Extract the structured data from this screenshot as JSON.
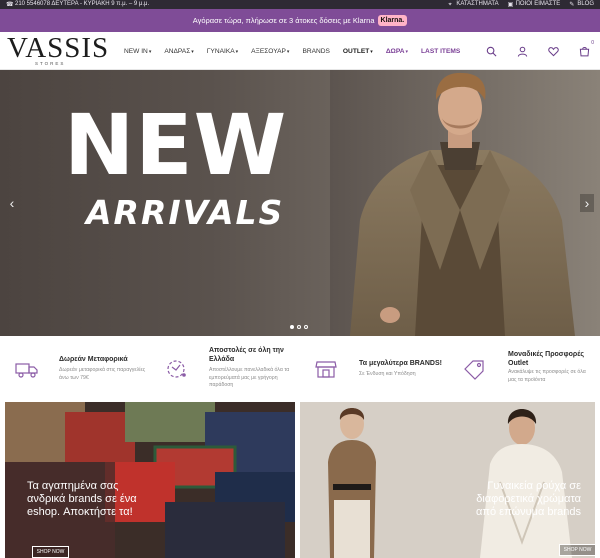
{
  "util_bar": {
    "phone": "210 5546078 ΔΕΥΤΕΡΑ - ΚΥΡΙΑΚΗ 9 π.μ. – 9 μ.μ.",
    "links": [
      "ΚΑΤΑΣΤΗΜΑΤΑ",
      "ΠΟΙΟΙ ΕΙΜΑΣΤΕ",
      "BLOG"
    ]
  },
  "promo": {
    "text": "Αγόρασε τώρα, πλήρωσε σε 3 άτοκες δόσεις με Klarna",
    "badge": "Klarna."
  },
  "header": {
    "logo_main": "VASSIS",
    "logo_sub": "STORES",
    "nav": [
      {
        "label": "NEW IN",
        "caret": "▾",
        "style": "normal"
      },
      {
        "label": "ΑΝΔΡΑΣ",
        "caret": "▾",
        "style": "normal"
      },
      {
        "label": "ΓΥΝΑΙΚΑ",
        "caret": "▾",
        "style": "normal"
      },
      {
        "label": "ΑΞΕΣΟΥΑΡ",
        "caret": "▾",
        "style": "normal"
      },
      {
        "label": "BRANDS",
        "caret": "",
        "style": "normal"
      },
      {
        "label": "OUTLET",
        "caret": "▾",
        "style": "bold"
      },
      {
        "label": "ΔΩΡΑ",
        "caret": "▾",
        "style": "purple"
      },
      {
        "label": "LAST ITEMS",
        "caret": "",
        "style": "purple"
      }
    ],
    "icons": [
      "search-icon",
      "account-icon",
      "wishlist-icon",
      "cart-icon"
    ],
    "cart_count": "0"
  },
  "hero": {
    "headline": "NEW",
    "subheadline": "ARRIVALS",
    "prev": "‹",
    "next": "›",
    "slides": 3,
    "active_slide": 1
  },
  "features": [
    {
      "icon": "truck-icon",
      "title": "Δωρεάν Μεταφορικά",
      "desc": "Δωρεάν μεταφορικά στις παραγγελίες άνω των 79€"
    },
    {
      "icon": "globe-icon",
      "title": "Αποστολές σε όλη την Ελλάδα",
      "desc": "Αποστέλλουμε πανελλαδικά όλα τα εμπορεύματά μας με γρήγορη παράδοση"
    },
    {
      "icon": "store-icon",
      "title": "Τα μεγαλύτερα BRANDS!",
      "desc": "Σε Ένδυση και Υπόδηση"
    },
    {
      "icon": "tag-icon",
      "title": "Μοναδικές Προσφορές Outlet",
      "desc": "Ανακάλυψε τις προσφορές σε όλα μας τα προϊόντα"
    }
  ],
  "panels": {
    "left_text": "Τα αγαπημένα σας ανδρικά brands σε ένα eshop. Αποκτήστε τα!",
    "left_button": "SHOP NOW",
    "right_text": "Γυναικεία ρούχα σε διαφορετικά χρώματα από επώνυμα brands",
    "right_button": "SHOP NOW"
  },
  "colors": {
    "util_bg": "#2e2a34",
    "promo_bg": "#7f4c97",
    "accent": "#7a3f96",
    "klarna": "#ffb3c7"
  }
}
